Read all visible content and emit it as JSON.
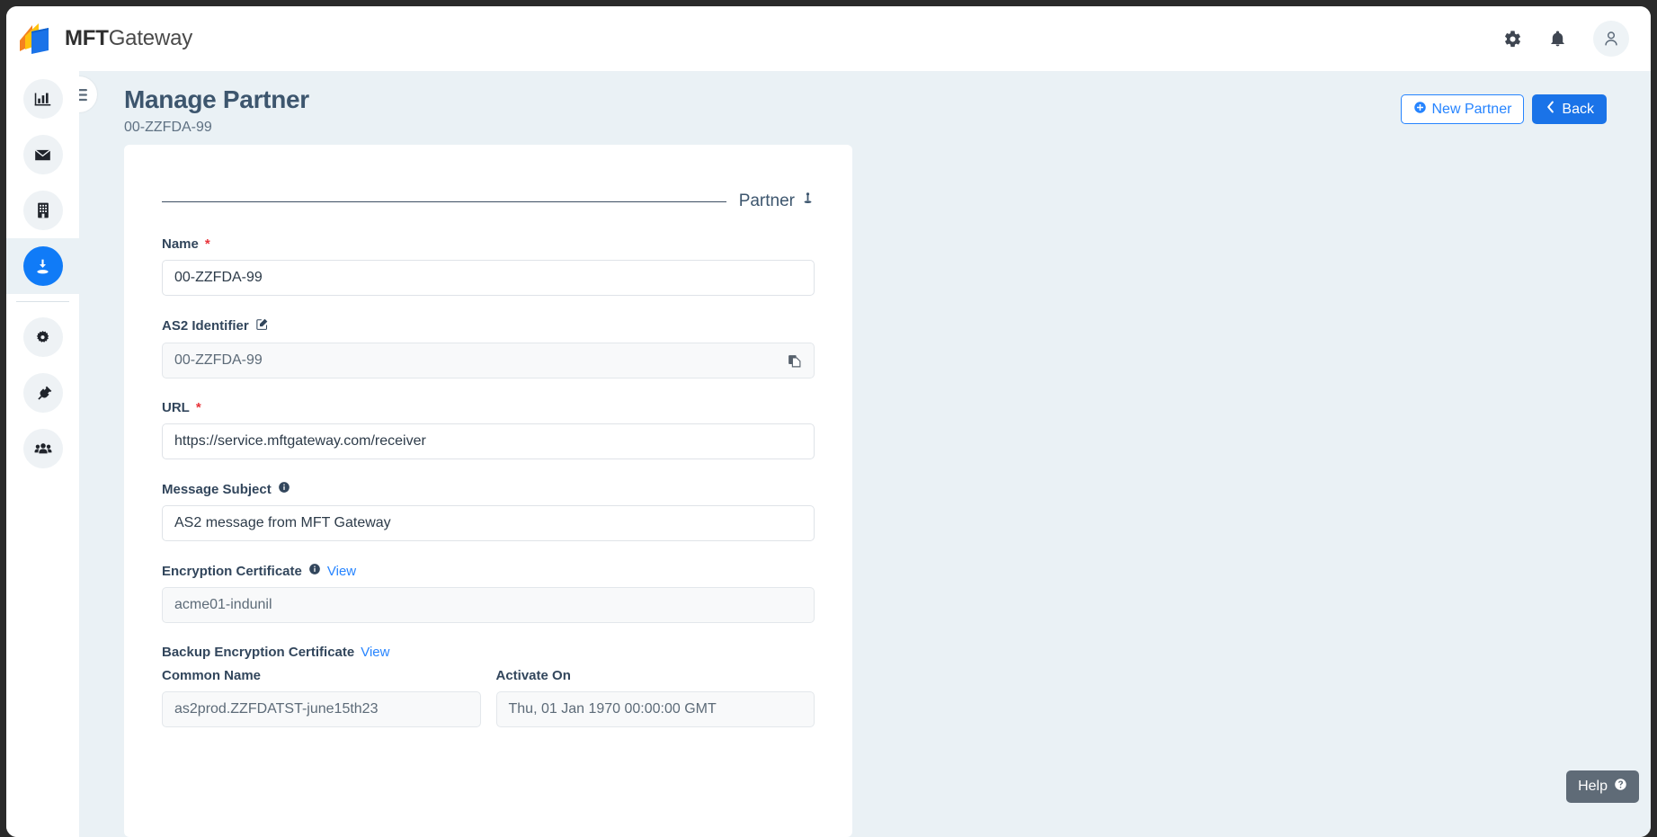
{
  "brand": {
    "bold": "MFT",
    "light": "Gateway"
  },
  "topbar": {
    "settings_icon": "gear-icon",
    "notifications_icon": "bell-icon",
    "account_icon": "user-avatar-icon"
  },
  "sidebar": {
    "items": [
      {
        "icon": "chart-bar-icon",
        "name": "dashboard",
        "active": false
      },
      {
        "icon": "envelope-icon",
        "name": "messages",
        "active": false
      },
      {
        "icon": "building-icon",
        "name": "stations",
        "active": false
      },
      {
        "icon": "download-person-icon",
        "name": "partners",
        "active": true
      },
      {
        "icon": "cog-icon",
        "name": "settings",
        "active": false
      },
      {
        "icon": "plug-icon",
        "name": "integrations",
        "active": false
      },
      {
        "icon": "users-icon",
        "name": "users",
        "active": false
      }
    ],
    "menu_toggle_icon": "hamburger-icon"
  },
  "header": {
    "title": "Manage Partner",
    "subtitle": "00-ZZFDA-99",
    "new_partner_label": "New Partner",
    "new_partner_icon": "plus-circle-icon",
    "back_label": "Back",
    "back_icon": "chevron-left-icon"
  },
  "form": {
    "section_label": "Partner",
    "section_icon": "person-icon",
    "name": {
      "label": "Name",
      "required": "*",
      "value": "00-ZZFDA-99"
    },
    "as2_identifier": {
      "label": "AS2 Identifier",
      "edit_icon": "edit-square-icon",
      "value": "00-ZZFDA-99",
      "copy_icon": "copy-icon"
    },
    "url": {
      "label": "URL",
      "required": "*",
      "value": "https://service.mftgateway.com/receiver"
    },
    "message_subject": {
      "label": "Message Subject",
      "info_icon": "info-circle-icon",
      "value": "AS2 message from MFT Gateway"
    },
    "encryption_certificate": {
      "label": "Encryption Certificate",
      "info_icon": "info-circle-icon",
      "view_label": "View",
      "value": "acme01-indunil"
    },
    "backup_encryption_certificate": {
      "label": "Backup Encryption Certificate",
      "view_label": "View",
      "common_name": {
        "label": "Common Name",
        "value": "as2prod.ZZFDATST-june15th23"
      },
      "activate_on": {
        "label": "Activate On",
        "value": "Thu, 01 Jan 1970 00:00:00 GMT"
      }
    }
  },
  "help": {
    "label": "Help",
    "icon": "question-circle-icon"
  },
  "colors": {
    "accent": "#107bf7",
    "primary_button": "#1a73e8",
    "outline_button": "#2684ff",
    "page_background": "#eaf1f5",
    "heading": "#3d566e",
    "required": "#e8343a",
    "help_background": "#5f6b77"
  }
}
